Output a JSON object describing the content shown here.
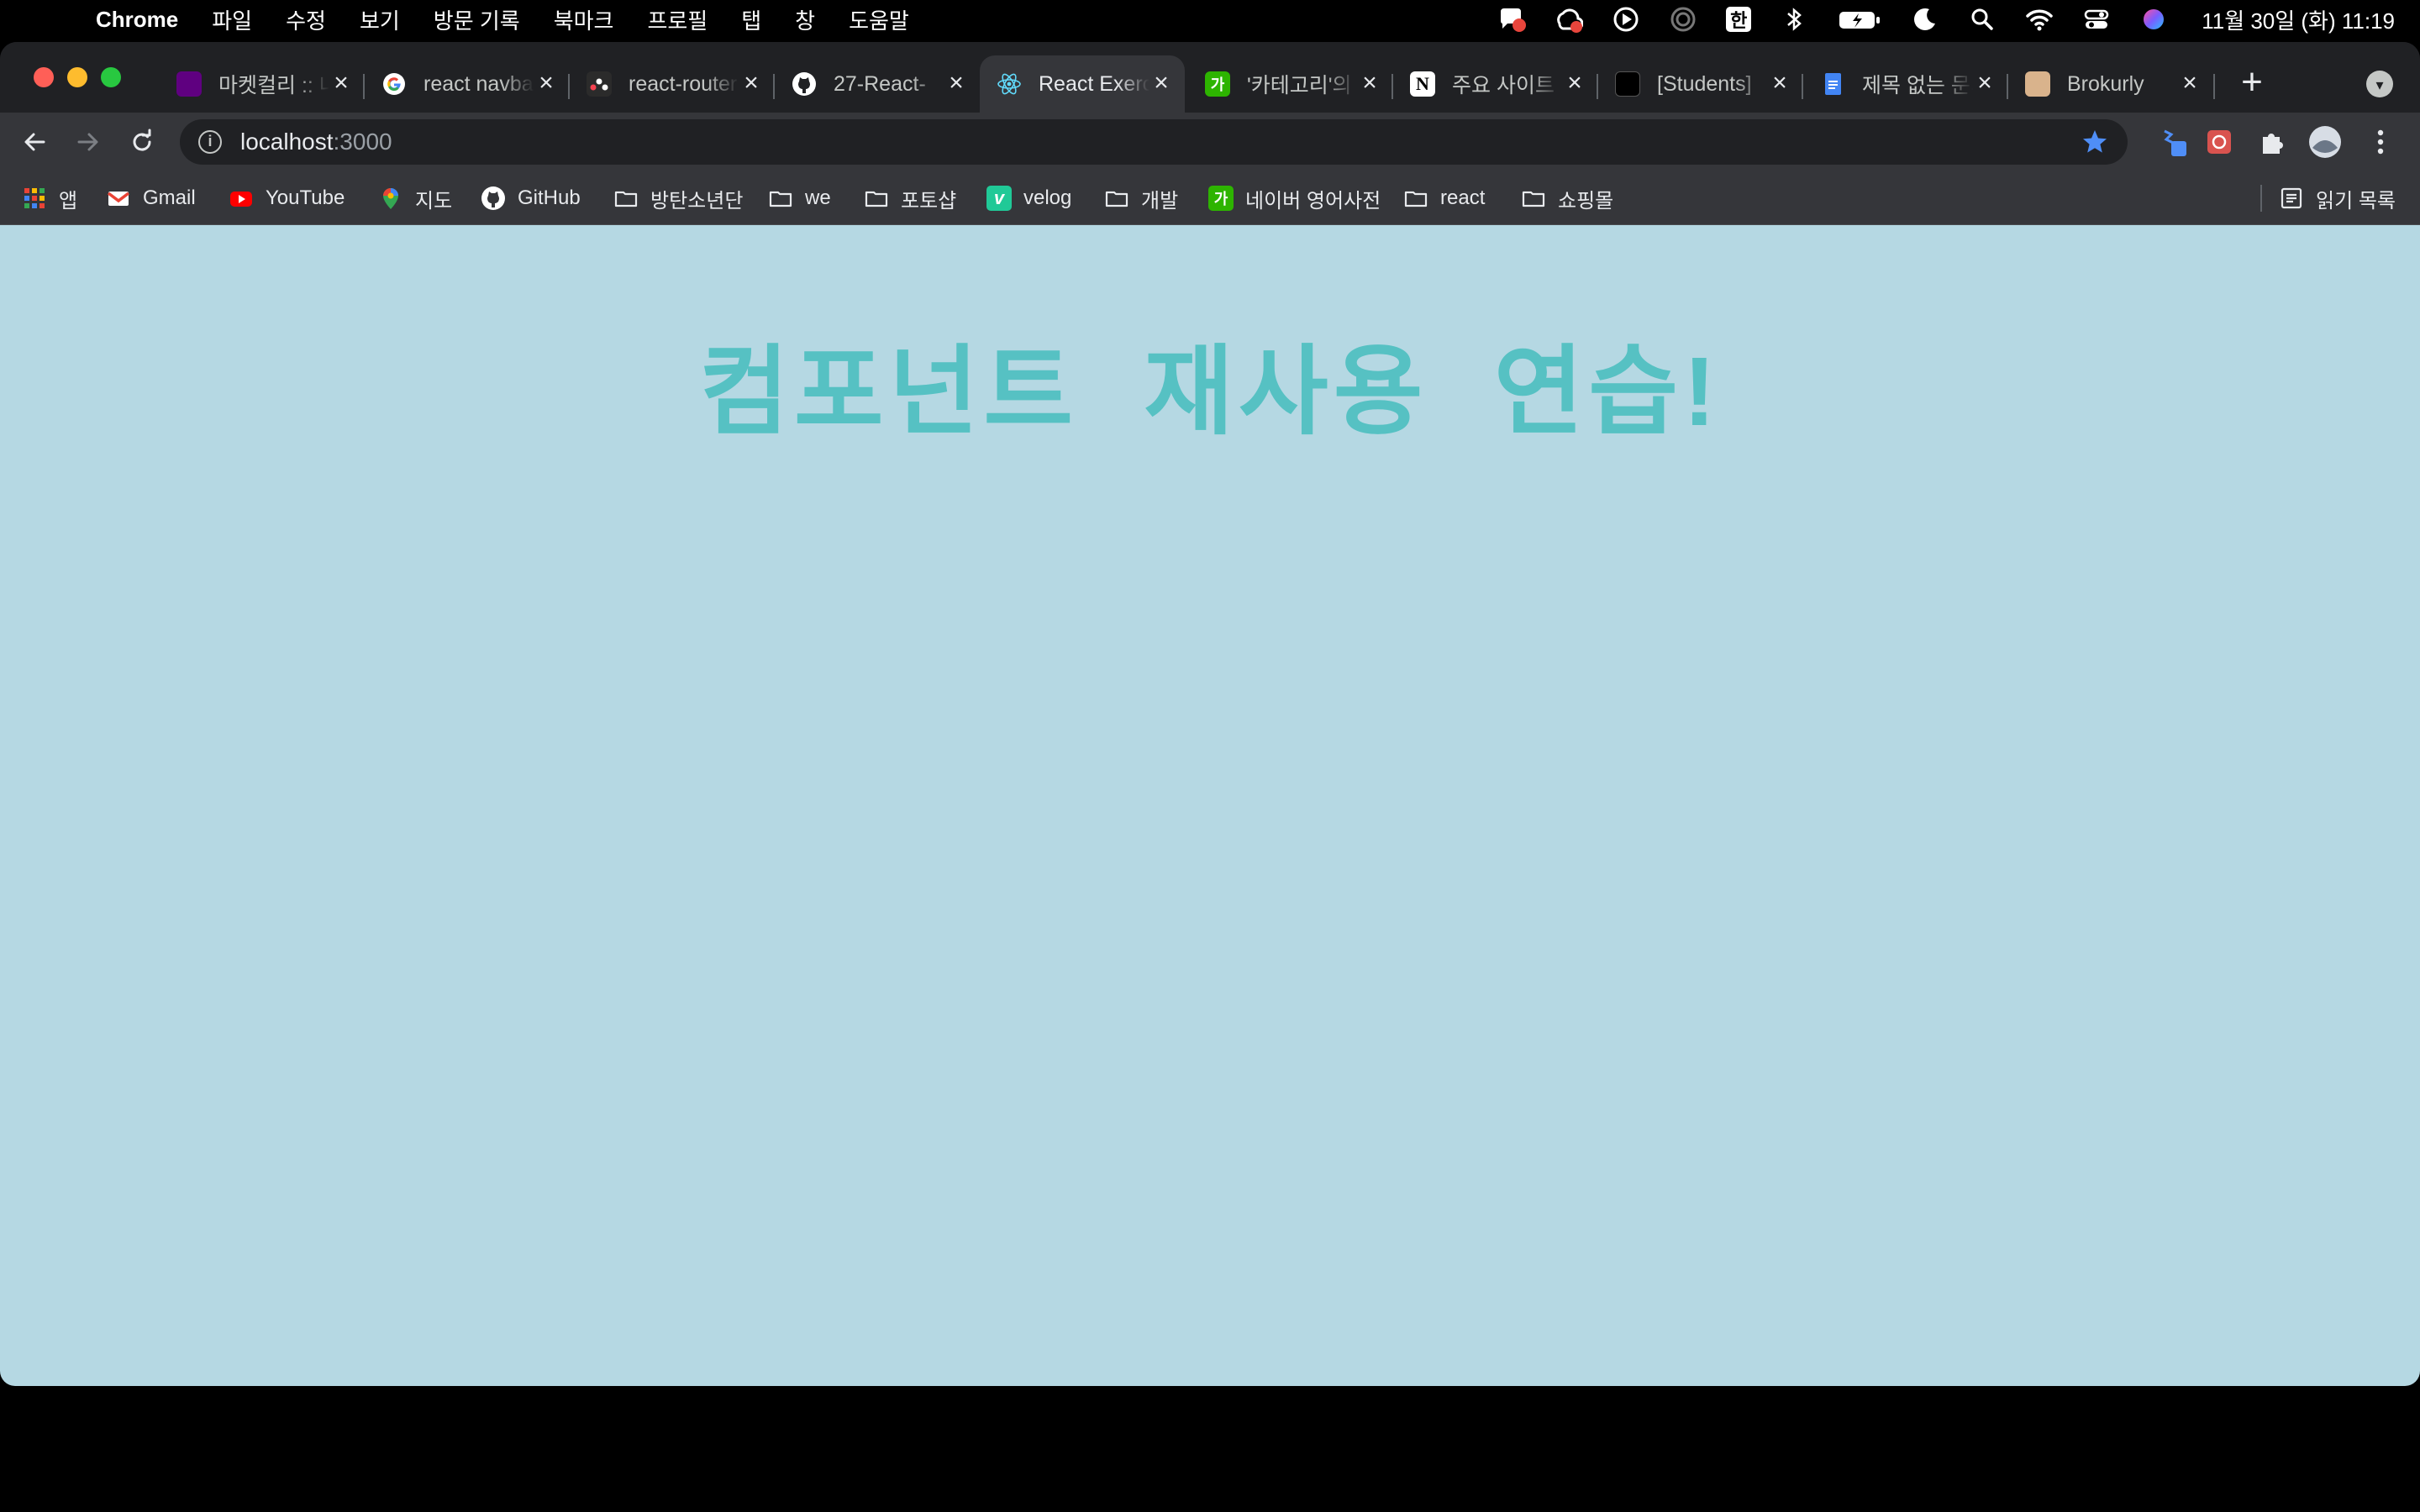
{
  "menubar": {
    "app_name": "Chrome",
    "items": [
      "파일",
      "수정",
      "보기",
      "방문 기록",
      "북마크",
      "프로필",
      "탭",
      "창",
      "도움말"
    ],
    "input_method": "한",
    "clock": "11월 30일 (화)  11:19"
  },
  "tabs": [
    {
      "title": "마켓컬리 :: 내일의 장보기",
      "favicon": "kurly-icon",
      "color": "#5f0080"
    },
    {
      "title": "react navbar",
      "favicon": "google-icon",
      "color": "#ffffff"
    },
    {
      "title": "react-router",
      "favicon": "react-router-icon",
      "color": "#2b2b2b"
    },
    {
      "title": "27-React-",
      "favicon": "github-icon",
      "color": "#ffffff"
    },
    {
      "title": "React Exercise",
      "favicon": "react-icon",
      "color": "#61dafb",
      "active": true
    },
    {
      "title": "'카테고리'의",
      "favicon": "naver-dictionary-icon",
      "color": "#2db400"
    },
    {
      "title": "주요 사이트",
      "favicon": "notion-icon",
      "color": "#ffffff"
    },
    {
      "title": "[Students]",
      "favicon": "site-icon",
      "color": "#000000"
    },
    {
      "title": "제목 없는 문서",
      "favicon": "google-docs-icon",
      "color": "#4285f4"
    },
    {
      "title": "Brokurly",
      "favicon": "brokurly-icon",
      "color": "#d9b38c"
    }
  ],
  "address_bar": {
    "host": "localhost",
    "port": ":3000"
  },
  "bookmarks": [
    {
      "label": "앱",
      "icon": "apps-grid-icon"
    },
    {
      "label": "Gmail",
      "icon": "gmail-icon"
    },
    {
      "label": "YouTube",
      "icon": "youtube-icon"
    },
    {
      "label": "지도",
      "icon": "maps-pin-icon"
    },
    {
      "label": "GitHub",
      "icon": "github-icon"
    },
    {
      "label": "방탄소년단",
      "icon": "folder-icon"
    },
    {
      "label": "we",
      "icon": "folder-icon"
    },
    {
      "label": "포토샵",
      "icon": "folder-icon"
    },
    {
      "label": "velog",
      "icon": "velog-icon"
    },
    {
      "label": "개발",
      "icon": "folder-icon"
    },
    {
      "label": "네이버 영어사전",
      "icon": "naver-dictionary-icon"
    },
    {
      "label": "react",
      "icon": "folder-icon"
    },
    {
      "label": "쇼핑몰",
      "icon": "folder-icon"
    }
  ],
  "reading_list": {
    "label": "읽기 목록",
    "icon": "reading-list-icon"
  },
  "page": {
    "heading": "컴포넌트 재사용 연습!",
    "background": "#b5d8e3",
    "heading_color": "#56c1c3"
  },
  "glyphs": {
    "apple": "",
    "close": "×",
    "plus": "+",
    "tab_search": "▾",
    "info": "i",
    "tab_badge_ka": "가",
    "velog_v": "v",
    "notion_n": "N"
  }
}
